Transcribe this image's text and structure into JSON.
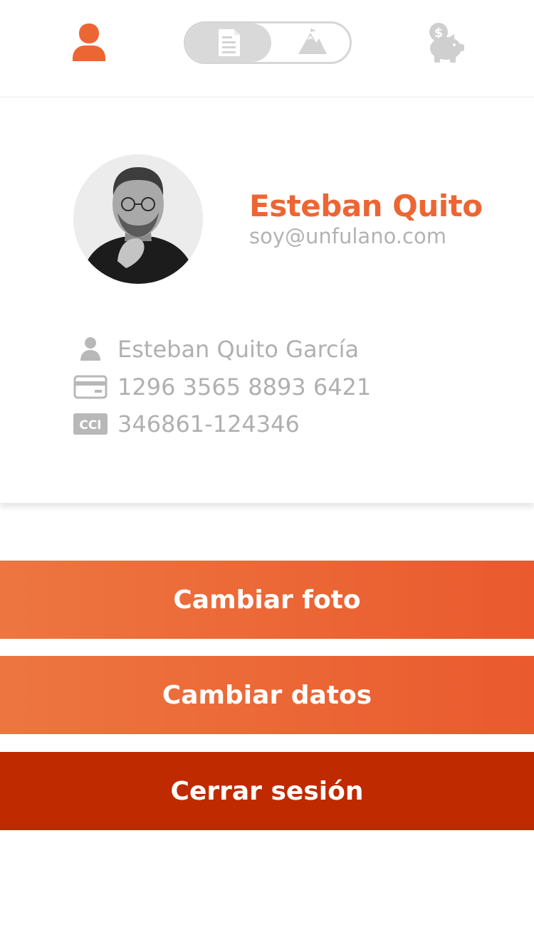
{
  "nav": {
    "profile_icon": "user-icon",
    "segment_left_icon": "document-icon",
    "segment_right_icon": "mountain-icon",
    "savings_icon": "piggy-bank-icon"
  },
  "profile": {
    "name": "Esteban Quito",
    "email": "soy@unfulano.com",
    "avatar": "avatar-photo"
  },
  "details": {
    "full_name": "Esteban Quito García",
    "card_number": "1296 3565 8893 6421",
    "cci_label": "CCI",
    "cci_number": "346861-124346"
  },
  "actions": {
    "change_photo": "Cambiar foto",
    "change_data": "Cambiar datos",
    "logout": "Cerrar sesión"
  },
  "colors": {
    "accent": "#ec6634",
    "accent_dark": "#c02a00",
    "muted_text": "#b0b0b0",
    "icon_gray": "#cfcfcf"
  }
}
